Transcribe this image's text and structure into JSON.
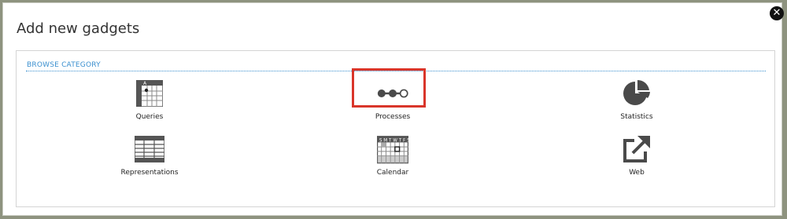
{
  "dialog": {
    "title": "Add new gadgets",
    "close_icon": "close-icon"
  },
  "section": {
    "label": "BROWSE CATEGORY"
  },
  "categories": [
    {
      "label": "Queries",
      "icon": "queries-grid-icon"
    },
    {
      "label": "Processes",
      "icon": "process-steps-icon",
      "highlighted": true
    },
    {
      "label": "Statistics",
      "icon": "pie-chart-icon"
    },
    {
      "label": "Representations",
      "icon": "table-icon"
    },
    {
      "label": "Calendar",
      "icon": "calendar-icon"
    },
    {
      "label": "Web",
      "icon": "external-link-icon"
    }
  ],
  "colors": {
    "accent": "#3a8fcf",
    "highlight": "#d9352a",
    "icon": "#4a4a4a"
  }
}
